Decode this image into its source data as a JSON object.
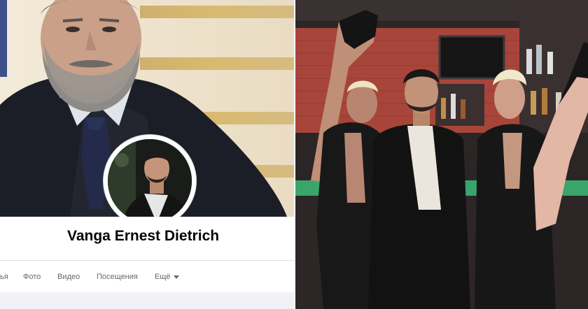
{
  "profile": {
    "name": "Vanga Ernest Dietrich"
  },
  "tabs": [
    {
      "label": "ья"
    },
    {
      "label": "Фото"
    },
    {
      "label": "Видео"
    },
    {
      "label": "Посещения"
    },
    {
      "label": "Ещё"
    }
  ],
  "colors": {
    "name_text": "#050505",
    "tab_text": "#65676b",
    "divider": "#dadde1",
    "page_background": "#f0f2f5",
    "wall_brick": "#a8453b",
    "counter_green": "#3aa56b"
  },
  "icons": {
    "more_caret": "chevron-down-icon"
  }
}
